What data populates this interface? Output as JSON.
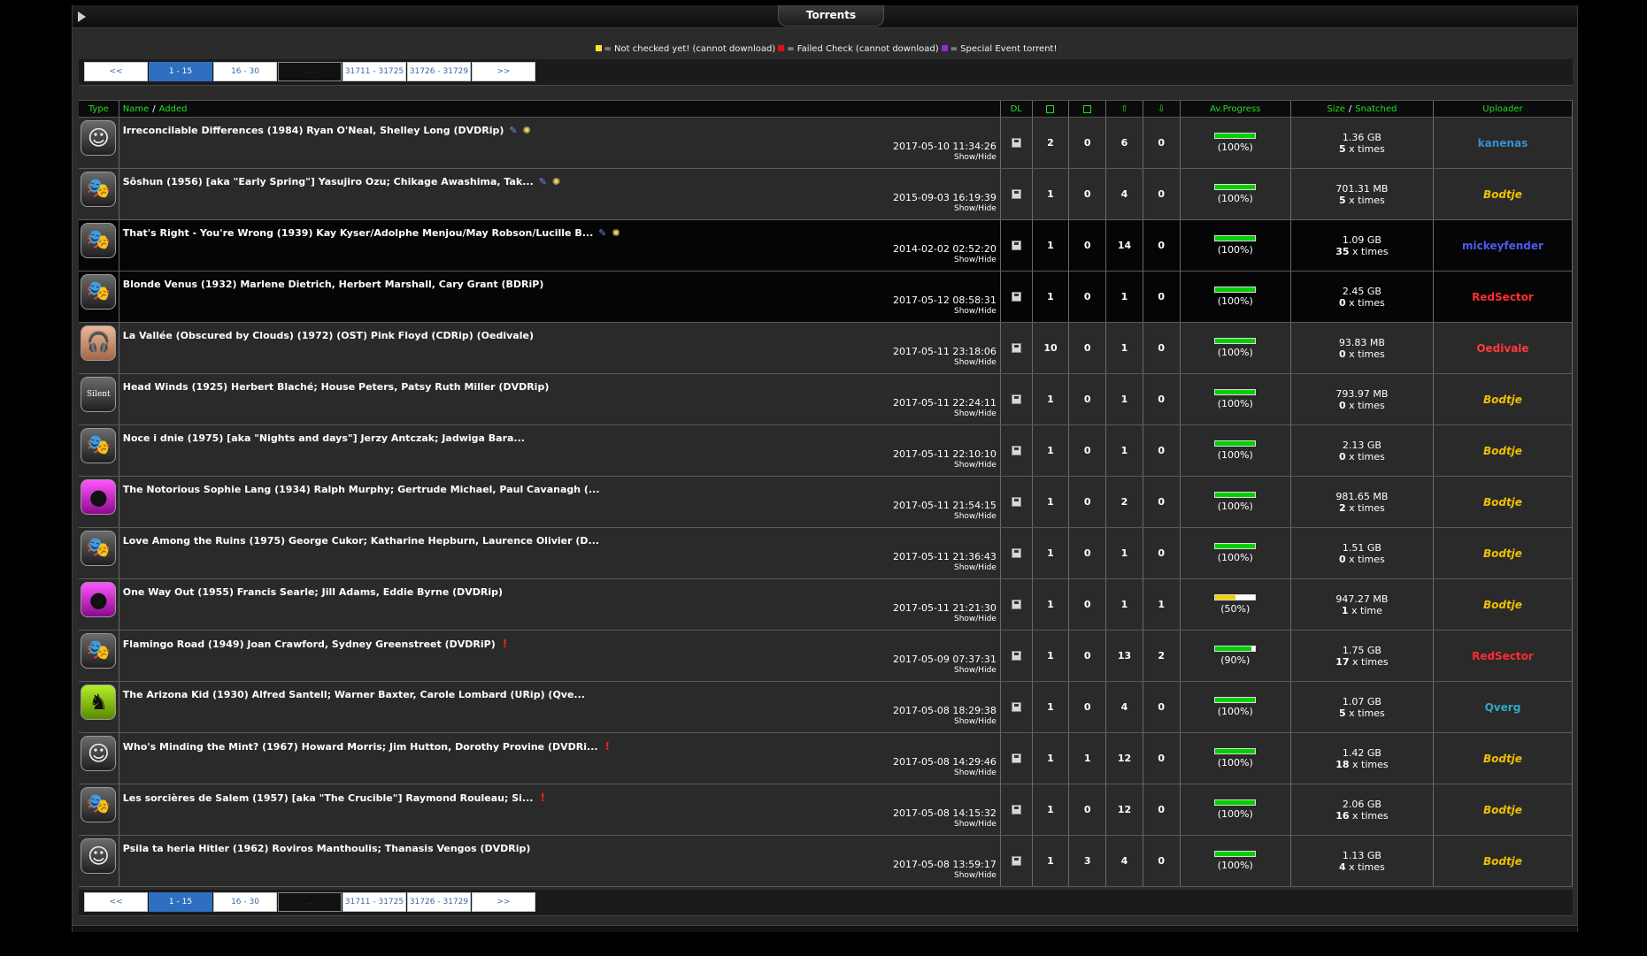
{
  "title": "Torrents",
  "legend": [
    {
      "color": "#f5e52e",
      "text": "= Not checked yet! (cannot download)"
    },
    {
      "color": "#e01010",
      "text": "= Failed Check (cannot download)"
    },
    {
      "color": "#8a2be2",
      "text": "= Special Event torrent!"
    }
  ],
  "pager": [
    "<<",
    "1 - 15",
    "16 - 30",
    "...",
    "31711 - 31725",
    "31726 - 31729",
    ">>"
  ],
  "headers": {
    "type": "Type",
    "name": "Name",
    "sep": "/",
    "added": "Added",
    "dl": "DL",
    "progress": "Av.Progress",
    "size": "Size",
    "snatched": "Snatched",
    "uploader": "Uploader"
  },
  "show_hide": "Show/Hide",
  "times_word": "times",
  "time_word": "time",
  "rows": [
    {
      "icon": "smiley",
      "title": "Irreconcilable Differences (1984) Ryan O'Neal, Shelley Long (DVDRip)",
      "pin": true,
      "bulb": true,
      "warn": false,
      "date": "2017-05-10 11:34:26",
      "c1": "2",
      "c2": "0",
      "c3": "6",
      "c4": "0",
      "progress": 100,
      "pct": "(100%)",
      "size": "1.36 GB",
      "snatched": "5",
      "uploader": "kanenas",
      "ucolor": "#3a8fd0",
      "italic": false,
      "dark": false
    },
    {
      "icon": "masks",
      "title": "Sôshun (1956) [aka \"Early Spring\"] Yasujiro Ozu; Chikage Awashima, Tak...",
      "pin": true,
      "bulb": true,
      "warn": false,
      "date": "2015-09-03 16:19:39",
      "c1": "1",
      "c2": "0",
      "c3": "4",
      "c4": "0",
      "progress": 100,
      "pct": "(100%)",
      "size": "701.31 MB",
      "snatched": "5",
      "uploader": "Bodtje",
      "ucolor": "#f0c000",
      "italic": true,
      "dark": false
    },
    {
      "icon": "masks",
      "title": "That's Right - You're Wrong (1939) Kay Kyser/Adolphe Menjou/May Robson/Lucille B...",
      "pin": true,
      "bulb": true,
      "warn": false,
      "date": "2014-02-02 02:52:20",
      "c1": "1",
      "c2": "0",
      "c3": "14",
      "c4": "0",
      "progress": 100,
      "pct": "(100%)",
      "size": "1.09 GB",
      "snatched": "35",
      "uploader": "mickeyfender",
      "ucolor": "#4a5cf0",
      "italic": false,
      "dark": true
    },
    {
      "icon": "masks",
      "title": "Blonde Venus (1932) Marlene Dietrich, Herbert Marshall, Cary Grant (BDRiP)",
      "pin": false,
      "bulb": false,
      "warn": false,
      "date": "2017-05-12 08:58:31",
      "c1": "1",
      "c2": "0",
      "c3": "1",
      "c4": "0",
      "progress": 100,
      "pct": "(100%)",
      "size": "2.45 GB",
      "snatched": "0",
      "uploader": "RedSector",
      "ucolor": "#ff2d2d",
      "italic": false,
      "dark": true
    },
    {
      "icon": "headphones",
      "title": "La Vallée (Obscured by Clouds) (1972) (OST) Pink Floyd (CDRip) (Oedivale)",
      "pin": false,
      "bulb": false,
      "warn": false,
      "date": "2017-05-11 23:18:06",
      "c1": "10",
      "c2": "0",
      "c3": "1",
      "c4": "0",
      "progress": 100,
      "pct": "(100%)",
      "size": "93.83 MB",
      "snatched": "0",
      "uploader": "Oedivale",
      "ucolor": "#ff3a3a",
      "italic": false,
      "dark": false
    },
    {
      "icon": "silent",
      "title": "Head Winds (1925) Herbert Blaché; House Peters, Patsy Ruth Miller (DVDRip)",
      "pin": false,
      "bulb": false,
      "warn": false,
      "date": "2017-05-11 22:24:11",
      "c1": "1",
      "c2": "0",
      "c3": "1",
      "c4": "0",
      "progress": 100,
      "pct": "(100%)",
      "size": "793.97 MB",
      "snatched": "0",
      "uploader": "Bodtje",
      "ucolor": "#f0c000",
      "italic": true,
      "dark": false
    },
    {
      "icon": "masks",
      "title": "Noce i dnie (1975) [aka \"Nights and days\"] Jerzy Antczak; Jadwiga Bara...",
      "pin": false,
      "bulb": false,
      "warn": false,
      "date": "2017-05-11 22:10:10",
      "c1": "1",
      "c2": "0",
      "c3": "1",
      "c4": "0",
      "progress": 100,
      "pct": "(100%)",
      "size": "2.13 GB",
      "snatched": "0",
      "uploader": "Bodtje",
      "ucolor": "#f0c000",
      "italic": true,
      "dark": false
    },
    {
      "icon": "pinkmask",
      "title": "The Notorious Sophie Lang (1934) Ralph Murphy; Gertrude Michael, Paul Cavanagh (...",
      "pin": false,
      "bulb": false,
      "warn": false,
      "date": "2017-05-11 21:54:15",
      "c1": "1",
      "c2": "0",
      "c3": "2",
      "c4": "0",
      "progress": 100,
      "pct": "(100%)",
      "size": "981.65 MB",
      "snatched": "2",
      "uploader": "Bodtje",
      "ucolor": "#f0c000",
      "italic": true,
      "dark": false
    },
    {
      "icon": "masks",
      "title": "Love Among the Ruins (1975) George Cukor; Katharine Hepburn, Laurence Olivier (D...",
      "pin": false,
      "bulb": false,
      "warn": false,
      "date": "2017-05-11 21:36:43",
      "c1": "1",
      "c2": "0",
      "c3": "1",
      "c4": "0",
      "progress": 100,
      "pct": "(100%)",
      "size": "1.51 GB",
      "snatched": "0",
      "uploader": "Bodtje",
      "ucolor": "#f0c000",
      "italic": true,
      "dark": false
    },
    {
      "icon": "pinkmask",
      "title": "One Way Out (1955) Francis Searle; Jill Adams, Eddie Byrne (DVDRip)",
      "pin": false,
      "bulb": false,
      "warn": false,
      "date": "2017-05-11 21:21:30",
      "c1": "1",
      "c2": "0",
      "c3": "1",
      "c4": "1",
      "progress": 50,
      "pct": "(50%)",
      "size": "947.27 MB",
      "snatched": "1",
      "uploader": "Bodtje",
      "ucolor": "#f0c000",
      "italic": true,
      "dark": false
    },
    {
      "icon": "masks",
      "title": "Flamingo Road (1949) Joan Crawford, Sydney Greenstreet (DVDRiP)",
      "pin": false,
      "bulb": false,
      "warn": true,
      "date": "2017-05-09 07:37:31",
      "c1": "1",
      "c2": "0",
      "c3": "13",
      "c4": "2",
      "progress": 90,
      "pct": "(90%)",
      "size": "1.75 GB",
      "snatched": "17",
      "uploader": "RedSector",
      "ucolor": "#ff2d2d",
      "italic": false,
      "dark": false
    },
    {
      "icon": "cowboy",
      "title": "The Arizona Kid (1930) Alfred Santell; Warner Baxter, Carole Lombard (URip) (Qve...",
      "pin": false,
      "bulb": false,
      "warn": false,
      "date": "2017-05-08 18:29:38",
      "c1": "1",
      "c2": "0",
      "c3": "4",
      "c4": "0",
      "progress": 100,
      "pct": "(100%)",
      "size": "1.07 GB",
      "snatched": "5",
      "uploader": "Qverg",
      "ucolor": "#2fa8c8",
      "italic": false,
      "dark": false
    },
    {
      "icon": "smiley",
      "title": "Who's Minding the Mint? (1967) Howard Morris; Jim Hutton, Dorothy Provine (DVDRi...",
      "pin": false,
      "bulb": false,
      "warn": true,
      "date": "2017-05-08 14:29:46",
      "c1": "1",
      "c2": "1",
      "c3": "12",
      "c4": "0",
      "progress": 100,
      "pct": "(100%)",
      "size": "1.42 GB",
      "snatched": "18",
      "uploader": "Bodtje",
      "ucolor": "#f0c000",
      "italic": true,
      "dark": false
    },
    {
      "icon": "masks",
      "title": "Les sorcières de Salem (1957) [aka \"The Crucible\"] Raymond Rouleau; Si...",
      "pin": false,
      "bulb": false,
      "warn": true,
      "date": "2017-05-08 14:15:32",
      "c1": "1",
      "c2": "0",
      "c3": "12",
      "c4": "0",
      "progress": 100,
      "pct": "(100%)",
      "size": "2.06 GB",
      "snatched": "16",
      "uploader": "Bodtje",
      "ucolor": "#f0c000",
      "italic": true,
      "dark": false
    },
    {
      "icon": "smiley",
      "title": "Psila ta heria Hitler (1962) Roviros Manthoulis; Thanasis Vengos (DVDRip)",
      "pin": false,
      "bulb": false,
      "warn": false,
      "date": "2017-05-08 13:59:17",
      "c1": "1",
      "c2": "3",
      "c3": "4",
      "c4": "0",
      "progress": 100,
      "pct": "(100%)",
      "size": "1.13 GB",
      "snatched": "4",
      "uploader": "Bodtje",
      "ucolor": "#f0c000",
      "italic": true,
      "dark": false
    }
  ]
}
